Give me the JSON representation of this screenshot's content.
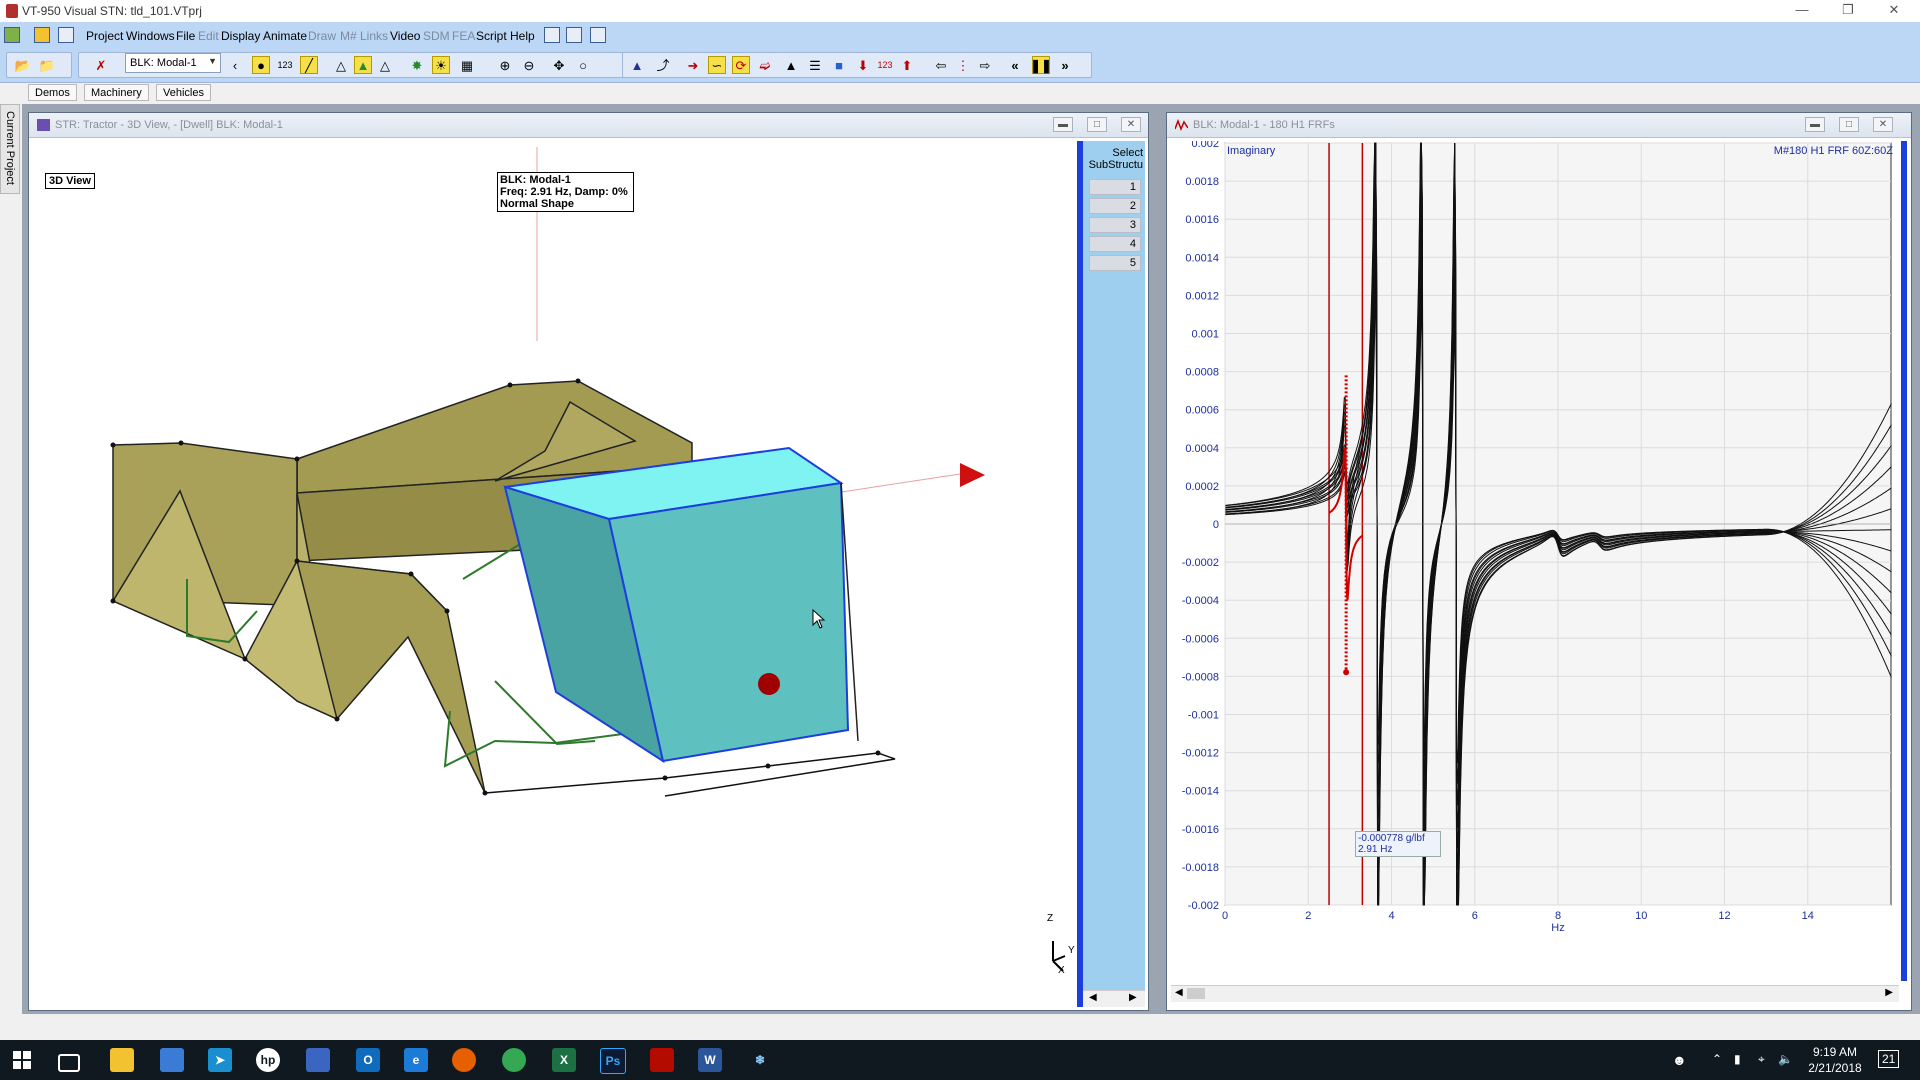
{
  "window": {
    "title": "VT-950 Visual STN: tld_101.VTprj"
  },
  "menu": {
    "items": [
      {
        "label": "Project",
        "enabled": true
      },
      {
        "label": "Windows",
        "enabled": true
      },
      {
        "label": "File",
        "enabled": true
      },
      {
        "label": "Edit",
        "enabled": false
      },
      {
        "label": "Display",
        "enabled": true
      },
      {
        "label": "Animate",
        "enabled": true
      },
      {
        "label": "Draw",
        "enabled": false
      },
      {
        "label": "M# Links",
        "enabled": false
      },
      {
        "label": "Video",
        "enabled": true
      },
      {
        "label": "SDM",
        "enabled": false
      },
      {
        "label": "FEA",
        "enabled": false
      },
      {
        "label": "Script",
        "enabled": true
      },
      {
        "label": "Help",
        "enabled": true
      }
    ]
  },
  "toolbar": {
    "shape_select": "BLK: Modal-1"
  },
  "project_tabs": [
    "Demos",
    "Machinery",
    "Vehicles"
  ],
  "side_tab": "Current Project",
  "view3d": {
    "title": "STR: Tractor - 3D View,  - [Dwell] BLK: Modal-1",
    "view_label": "3D View",
    "info_line1": "BLK: Modal-1",
    "info_line2": "Freq: 2.91 Hz, Damp: 0%",
    "info_line3": "Normal Shape",
    "substructures_header_1": "Select",
    "substructures_header_2": "SubStructu",
    "substructures": [
      "1",
      "2",
      "3",
      "4",
      "5"
    ],
    "axis_labels": {
      "z": "Z",
      "y": "Y",
      "x": "X"
    }
  },
  "frf": {
    "title": "BLK: Modal-1 - 180 H1 FRFs",
    "component_label": "Imaginary",
    "trace_label": "M#180 H1 FRF 60Z:60Z",
    "x_unit": "Hz",
    "cursor_value": "-0.000778 g/lbf",
    "cursor_freq": "2.91 Hz",
    "y_ticks": [
      "0.002",
      "0.0018",
      "0.0016",
      "0.0014",
      "0.0012",
      "0.001",
      "0.0008",
      "0.0006",
      "0.0004",
      "0.0002",
      "0",
      "-0.0002",
      "-0.0004",
      "-0.0006",
      "-0.0008",
      "-0.001",
      "-0.0012",
      "-0.0014",
      "-0.0016",
      "-0.0018",
      "-0.002"
    ],
    "x_ticks": [
      "0",
      "2",
      "4",
      "6",
      "8",
      "10",
      "12",
      "14"
    ]
  },
  "colors": {
    "accent_blue": "#1c3fdc",
    "cursor_red": "#c00000",
    "panel_cyan": "#9ecfee"
  },
  "taskbar": {
    "apps": [
      "windows-start",
      "task-view",
      "file-explorer",
      "store",
      "vt-app",
      "hp",
      "contacts",
      "outlook",
      "edge",
      "firefox",
      "chrome",
      "excel",
      "photoshop",
      "acrobat",
      "word",
      "settings-app"
    ],
    "time": "9:19 AM",
    "date": "2/21/2018",
    "notification_count": "21"
  }
}
